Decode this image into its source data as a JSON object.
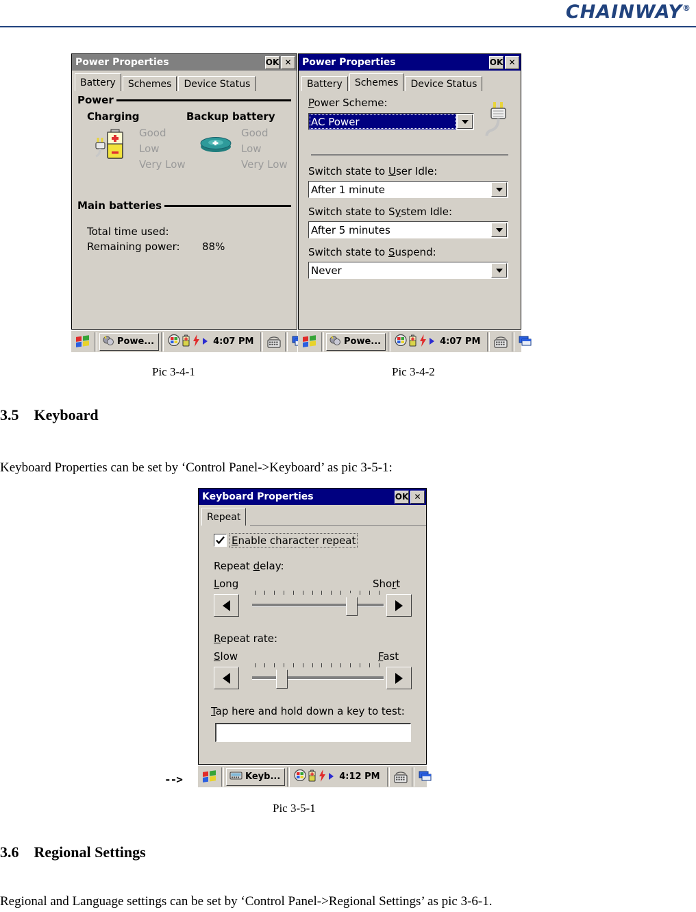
{
  "header": {
    "brand": "CHAINWAY",
    "brand_mark": "®"
  },
  "power_dialog_battery": {
    "title": "Power Properties",
    "ok_label": "OK",
    "close_label": "✕",
    "tabs": [
      {
        "label": "Battery",
        "selected": true
      },
      {
        "label": "Schemes",
        "selected": false
      },
      {
        "label": "Device Status",
        "selected": false
      }
    ],
    "group_power_label": "Power",
    "charging_header": "Charging",
    "backup_header": "Backup battery",
    "charging_states": [
      "Good",
      "Low",
      "Very Low"
    ],
    "backup_states": [
      "Good",
      "Low",
      "Very Low"
    ],
    "group_main_batteries_label": "Main batteries",
    "total_time_label": "Total time used:",
    "remaining_power_label": "Remaining power:",
    "remaining_power_value": "88%",
    "icon_charging": "battery-charging-icon",
    "icon_backup": "coin-cell-battery-icon"
  },
  "power_dialog_schemes": {
    "title": "Power Properties",
    "ok_label": "OK",
    "close_label": "✕",
    "tabs": [
      {
        "label": "Battery",
        "selected": false
      },
      {
        "label": "Schemes",
        "selected": true
      },
      {
        "label": "Device Status",
        "selected": false
      }
    ],
    "power_scheme_label_pre": "",
    "power_scheme_label_mn": "P",
    "power_scheme_label_post": "ower Scheme:",
    "power_scheme_value": "AC Power",
    "icon_plug": "ac-plug-icon",
    "fields": [
      {
        "label_pre": "Switch state to ",
        "label_mn": "U",
        "label_post": "ser Idle:",
        "value": "After 1 minute"
      },
      {
        "label_pre": "Switch state to S",
        "label_mn": "y",
        "label_post": "stem Idle:",
        "value": "After 5 minutes"
      },
      {
        "label_pre": "Switch state to ",
        "label_mn": "S",
        "label_post": "uspend:",
        "value": "Never"
      }
    ]
  },
  "taskbar_left": {
    "start_icon": "windows-start-icon",
    "task_label": "Powe...",
    "task_icon": "power-properties-icon",
    "tray_icons": [
      "network-icon",
      "battery-icon",
      "lightning-icon",
      "play-icon"
    ],
    "clock": "4:07 PM",
    "sip_icon": "keyboard-icon",
    "desktop_icon": "show-desktop-icon"
  },
  "taskbar_right": {
    "start_icon": "windows-start-icon",
    "task_label": "Powe...",
    "task_icon": "power-properties-icon",
    "tray_icons": [
      "network-icon",
      "battery-icon",
      "lightning-icon",
      "play-icon"
    ],
    "clock": "4:07 PM",
    "sip_icon": "keyboard-icon",
    "desktop_icon": "show-desktop-icon"
  },
  "captions": {
    "pic_3_4_1": "Pic 3-4-1",
    "pic_3_4_2": "Pic 3-4-2",
    "pic_3_5_1": "Pic 3-5-1"
  },
  "sections": {
    "keyboard_heading_num": "3.5",
    "keyboard_heading_text": "Keyboard",
    "keyboard_paragraph": "Keyboard Properties can be set by ‘Control Panel->Keyboard’ as pic 3-5-1:",
    "regional_heading_num": "3.6",
    "regional_heading_text": "Regional Settings",
    "regional_paragraph": "Regional and Language settings can be set by ‘Control Panel->Regional Settings’ as pic 3-6-1."
  },
  "arrow_marker": "-->",
  "keyboard_dialog": {
    "title": "Keyboard Properties",
    "ok_label": "OK",
    "close_label": "✕",
    "tabs": [
      {
        "label": "Repeat",
        "selected": true
      }
    ],
    "enable_repeat": {
      "checked": true,
      "label_mn": "E",
      "label_post": "nable character repeat"
    },
    "repeat_delay": {
      "label_pre": "Repeat ",
      "label_mn": "d",
      "label_post": "elay:",
      "min_label_mn": "L",
      "min_label_post": "ong",
      "max_label_pre": "Sho",
      "max_label_mn": "r",
      "max_label_post": "t",
      "value_percent": 78,
      "ticks": 14
    },
    "repeat_rate": {
      "label_mn": "R",
      "label_post": "epeat rate:",
      "min_label_mn": "S",
      "min_label_post": "low",
      "max_label_mn": "F",
      "max_label_post": "ast",
      "value_percent": 20,
      "ticks": 14
    },
    "test_label_mn": "T",
    "test_label_post": "ap here and hold down a key to test:",
    "test_value": "",
    "taskbar": {
      "start_icon": "windows-start-icon",
      "task_label": "Keyb...",
      "task_icon": "keyboard-properties-icon",
      "tray_icons": [
        "network-icon",
        "battery-icon",
        "lightning-icon",
        "play-icon"
      ],
      "clock": "4:12 PM",
      "sip_icon": "keyboard-icon",
      "desktop_icon": "show-desktop-icon"
    }
  },
  "colors": {
    "brand_blue": "#21437e",
    "title_active": "#000080",
    "title_inactive": "#808080",
    "face": "#d4d0c8",
    "disabled_text": "#9a9a9a"
  }
}
